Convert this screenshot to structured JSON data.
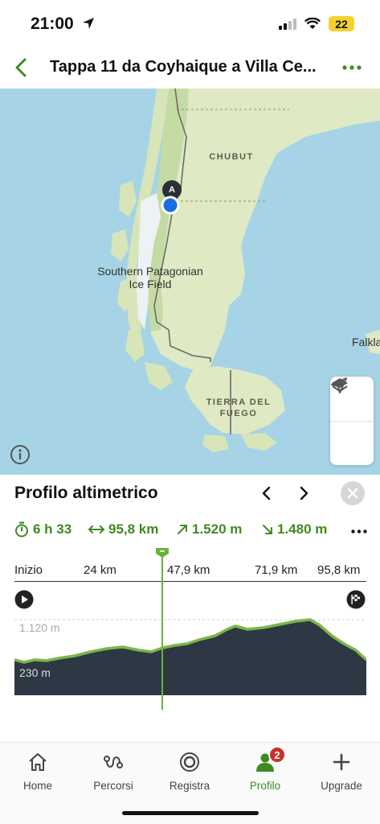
{
  "status_bar": {
    "time": "21:00",
    "battery": "22",
    "icons": [
      "location-arrow-icon",
      "signal-icon",
      "wifi-icon",
      "battery-icon"
    ]
  },
  "header": {
    "title": "Tappa 11 da Coyhaique a Villa Ce...",
    "icons": [
      "back-chevron-icon",
      "more-dots-icon"
    ],
    "accent": "#3f8a21"
  },
  "map": {
    "labels": {
      "chubut": "CHUBUT",
      "ice_field_line1": "Southern Patagonian",
      "ice_field_line2": "Ice Field",
      "falkland": "Falkla",
      "tierra_line1": "TIERRA DEL",
      "tierra_line2": "FUEGO"
    },
    "pin_letter": "A",
    "colors": {
      "water": "#a6d4e6",
      "land": "#dfe9c4",
      "land_green": "#c4dba4",
      "ice": "#edf2f4"
    },
    "icons": [
      "layers-icon",
      "locate-arrow-icon",
      "info-icon"
    ]
  },
  "profile": {
    "title": "Profilo altimetrico",
    "icons": [
      "chevron-left-icon",
      "chevron-right-icon",
      "close-icon"
    ],
    "stats": {
      "duration": "6 h 33",
      "distance": "95,8 km",
      "ascent": "1.520 m",
      "descent": "1.480 m"
    },
    "axis": {
      "start": "Inizio",
      "km1": "24 km",
      "km2": "47,9 km",
      "km3": "71,9 km",
      "km4": "95,8 km"
    },
    "elevation_high": "1.120 m",
    "elevation_low": "230 m",
    "cursor_fraction": 0.42,
    "colors": {
      "profile_fill": "#2e3744",
      "profile_line": "#7ab648",
      "accent": "#3f8a21"
    }
  },
  "tabbar": {
    "tabs": [
      {
        "label": "Home",
        "icon": "home-icon"
      },
      {
        "label": "Percorsi",
        "icon": "route-icon"
      },
      {
        "label": "Registra",
        "icon": "record-icon"
      },
      {
        "label": "Profilo",
        "icon": "profile-icon",
        "active": true,
        "badge": "2"
      },
      {
        "label": "Upgrade",
        "icon": "plus-icon"
      }
    ]
  }
}
